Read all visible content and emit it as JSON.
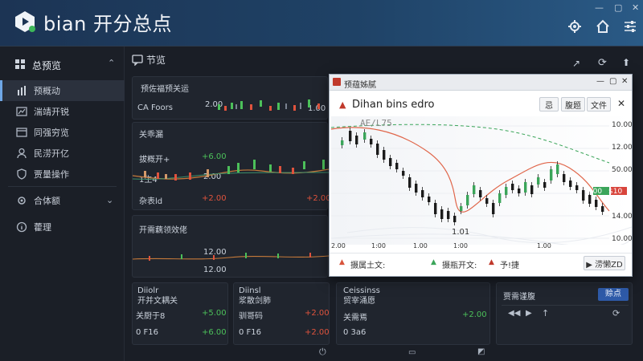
{
  "app": {
    "title": "bian 开分总点"
  },
  "sidebar": {
    "header": "总预览",
    "items": [
      {
        "label": "预概动",
        "icon": "bar-chart-icon",
        "active": true
      },
      {
        "label": "湍靖开锐",
        "icon": "chart-window-icon"
      },
      {
        "label": "同强穷览",
        "icon": "window-icon"
      },
      {
        "label": "民涝开亿",
        "icon": "user-icon"
      },
      {
        "label": "贾量操作",
        "icon": "shield-icon"
      }
    ],
    "group": {
      "label": "合体额",
      "icon": "gear-icon"
    },
    "extra": {
      "label": "藿理",
      "icon": "info-icon"
    }
  },
  "main": {
    "title": "节览"
  },
  "card1": {
    "title": "预佐福预关运",
    "name": "CA Foors",
    "value1": "2.00",
    "value2": "1.00"
  },
  "card2": {
    "title": "关乖漏",
    "row1_label": "拔概开+",
    "row1_value": "+6.00",
    "mid_label": "1生4",
    "mid_value": "2.00",
    "row3_label": "杂表ld",
    "row3_value": "+2.00",
    "red_value": "+2.00"
  },
  "card3": {
    "title": "开需藕领效佬",
    "value1": "12.00",
    "value2": "12.00"
  },
  "bottom_cards": [
    {
      "title": "Diiolr",
      "sub": "开并文耦关",
      "r1l": "关厨于8",
      "r1v": "+5.00",
      "r2l": "0 F16",
      "r2v": "+6.00"
    },
    {
      "title": "Diinsl",
      "sub": "浆散剑肺",
      "r1l": "驯哥码",
      "r1v": "+2.00",
      "r2l": "0 F16",
      "r2v": "+2.00"
    },
    {
      "title": "Ceissinss",
      "sub": "贸宰涌愿",
      "r1l": "关需焉",
      "r1v": "+2.00",
      "r2l": "0 3a6",
      "r2v": ""
    }
  ],
  "media": {
    "title": "贾需谨腹",
    "button": "赊点"
  },
  "popup": {
    "window_title": "预蕴姊腻",
    "chart_title": "Dihan bins edro",
    "btn1": "忌",
    "btn2": "腹题",
    "btn3": "文件",
    "watermark": "AE/L75",
    "y_ticks": [
      "10.00",
      "12.00",
      "50.00",
      "14.00",
      "10.00"
    ],
    "x_ticks": [
      "2.00",
      "1:00",
      "1.00",
      "1:00",
      "1.00"
    ],
    "price_label": "2.00",
    "price_label_red": "$10",
    "bottom_label": "1.01",
    "legend": [
      {
        "label": "摄属土文:",
        "color": "#d8543c"
      },
      {
        "label": "摄瓶开文:",
        "color": "#3ba55a"
      },
      {
        "label": "予!捷",
        "color": "#c0392b"
      }
    ],
    "action": "▶ 涝懒ZD"
  },
  "colors": {
    "up": "#4cc05a",
    "down": "#e0533d",
    "accent": "#6fa7e6"
  }
}
